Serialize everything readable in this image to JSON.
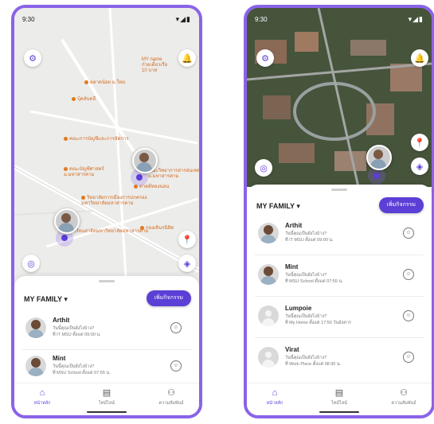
{
  "status": {
    "time": "9:30",
    "icons": "▾◢▮"
  },
  "left": {
    "places": [
      {
        "label": "MY name\nก๋วยเตี๋ยวเรือ\n10 บาท"
      },
      {
        "label": "ตลาดน้อย ม.ใหม่"
      },
      {
        "label": "บุ้คลับคลี"
      },
      {
        "label": "คณะการบัญชีและการจัดการ"
      },
      {
        "label": "คณะบัญชีศาสตร์\nม.มหาสารคาม"
      },
      {
        "label": "คณะวิทยาการสารสนเทศ\nม.มหาสารคาม"
      },
      {
        "label": "ตาดตีทองนอน"
      },
      {
        "label": "วิทยาลัยการเมืองการปกครอง\nมหาวิทยาลัยมหาสารคาม"
      },
      {
        "label": "โรงเรียนสาธิตมหาวิทยาลัยมหาสารคาม"
      },
      {
        "label": "กองเดินรนิสิต"
      }
    ],
    "family_title": "MY FAMILY ▾",
    "add_button": "เพิ่มกิจกรรม",
    "members": [
      {
        "name": "Arthit",
        "line1": "วันนี้คุณเป็นยังไงบ้าง?",
        "line2": "ที่ IT MSU ตั้งแต่ 09:00 น."
      },
      {
        "name": "Mint",
        "line1": "วันนี้คุณเป็นยังไงบ้าง?",
        "line2": "ที่ MSU School ตั้งแต่ 07:55 น."
      }
    ]
  },
  "right": {
    "family_title": "MY FAMILY ▾",
    "add_button": "เพิ่มกิจกรรม",
    "members": [
      {
        "name": "Arthit",
        "line1": "วันนี้คุณเป็นยังไงบ้าง?",
        "line2": "ที่ IT MSU ตั้งแต่ 09:00 น."
      },
      {
        "name": "Mint",
        "line1": "วันนี้คุณเป็นยังไงบ้าง?",
        "line2": "ที่ MSU School ตั้งแต่ 07:55 น."
      },
      {
        "name": "Lumpoie",
        "line1": "วันนี้คุณเป็นยังไงบ้าง?",
        "line2": "ที่ My Home ตั้งแต่ 17:50 วันอังคาร"
      },
      {
        "name": "Virat",
        "line1": "วันนี้คุณเป็นยังไงบ้าง?",
        "line2": "ที่ Work Place ตั้งแต่ 08:30 น."
      }
    ]
  },
  "nav": [
    {
      "label": "หน้าหลัก",
      "icon": "home-icon",
      "glyph": "⌂"
    },
    {
      "label": "ไทม์ไลน์",
      "icon": "timeline-icon",
      "glyph": "▤"
    },
    {
      "label": "ความสัมพันธ์",
      "icon": "relationship-icon",
      "glyph": "⚇"
    }
  ],
  "colors": {
    "accent": "#5b3fd6",
    "frame": "#8a63e8"
  }
}
